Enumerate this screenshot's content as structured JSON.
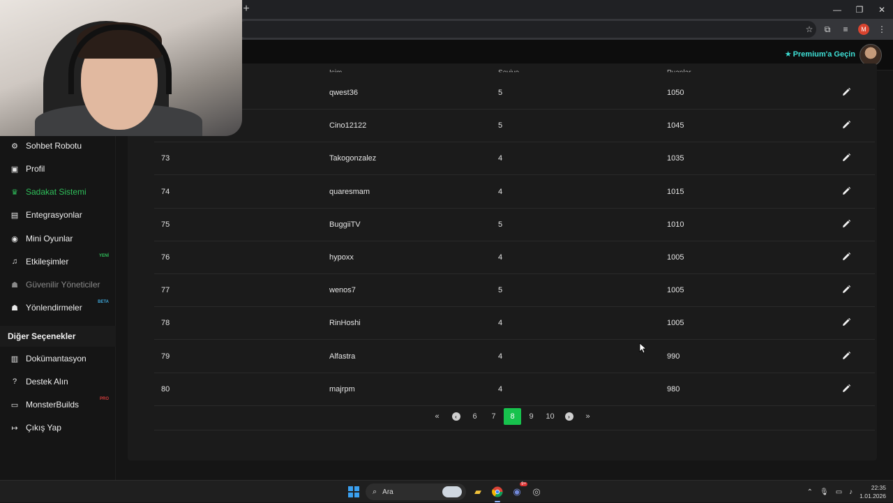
{
  "browser": {
    "new_tab_symbol": "+",
    "window_controls": [
      "—",
      "❐",
      "✕"
    ],
    "toolbar_icons": [
      "star-icon",
      "extensions-icon",
      "media-icon",
      "profile-icon",
      "menu-icon"
    ],
    "profile_letter": "M"
  },
  "header": {
    "premium_label": "Premium'a Geçin"
  },
  "sidebar": {
    "items": [
      {
        "label": "Sohbet Robotu",
        "icon": "robot-icon",
        "glyph": "⚙",
        "state": "normal",
        "badge": ""
      },
      {
        "label": "Profil",
        "icon": "id-card-icon",
        "glyph": "▣",
        "state": "normal",
        "badge": ""
      },
      {
        "label": "Sadakat Sistemi",
        "icon": "trophy-icon",
        "glyph": "♛",
        "state": "active",
        "badge": ""
      },
      {
        "label": "Entegrasyonlar",
        "icon": "integrations-icon",
        "glyph": "▤",
        "state": "normal",
        "badge": ""
      },
      {
        "label": "Mini Oyunlar",
        "icon": "gamepad-icon",
        "glyph": "◉",
        "state": "normal",
        "badge": ""
      },
      {
        "label": "Etkileşimler",
        "icon": "music-icon",
        "glyph": "♫",
        "state": "normal",
        "badge": "YENİ"
      },
      {
        "label": "Güvenilir Yöneticiler",
        "icon": "users-cog-icon",
        "glyph": "☗",
        "state": "disabled",
        "badge": ""
      },
      {
        "label": "Yönlendirmeler",
        "icon": "users-icon",
        "glyph": "☗",
        "state": "normal",
        "badge": "BETA"
      }
    ],
    "section_title": "Diğer Seçenekler",
    "other_items": [
      {
        "label": "Dokümantasyon",
        "icon": "scroll-icon",
        "glyph": "▥",
        "badge": ""
      },
      {
        "label": "Destek Alın",
        "icon": "question-circle-icon",
        "glyph": "?",
        "badge": ""
      },
      {
        "label": "MonsterBuilds",
        "icon": "laptop-icon",
        "glyph": "▭",
        "badge": "PRO"
      },
      {
        "label": "Çıkış Yap",
        "icon": "sign-out-icon",
        "glyph": "↦",
        "badge": ""
      }
    ],
    "colors": {
      "active": "#2fbf5a",
      "badge_new": "#2fbf5a",
      "badge_beta": "#3ea6d8",
      "badge_pro": "#d03b3b"
    }
  },
  "table": {
    "headers": [
      "İsim",
      "Seviye",
      "Puanlar"
    ],
    "rows": [
      {
        "rank": "",
        "name": "qwest36",
        "level": "5",
        "points": "1050"
      },
      {
        "rank": "",
        "name": "Cino12122",
        "level": "5",
        "points": "1045"
      },
      {
        "rank": "73",
        "name": "Takogonzalez",
        "level": "4",
        "points": "1035"
      },
      {
        "rank": "74",
        "name": "quaresmam",
        "level": "4",
        "points": "1015"
      },
      {
        "rank": "75",
        "name": "BuggiiTV",
        "level": "5",
        "points": "1010"
      },
      {
        "rank": "76",
        "name": "hypoxx",
        "level": "4",
        "points": "1005"
      },
      {
        "rank": "77",
        "name": "wenos7",
        "level": "5",
        "points": "1005"
      },
      {
        "rank": "78",
        "name": "RinHoshi",
        "level": "4",
        "points": "1005"
      },
      {
        "rank": "79",
        "name": "Alfastra",
        "level": "4",
        "points": "990"
      },
      {
        "rank": "80",
        "name": "majrpm",
        "level": "4",
        "points": "980"
      }
    ]
  },
  "pagination": {
    "first": "«",
    "prev": "‹",
    "pages": [
      "6",
      "7",
      "8",
      "9",
      "10"
    ],
    "current": "8",
    "next": "›",
    "last": "»",
    "current_color": "#17c24d"
  },
  "taskbar": {
    "search_label": "Ara",
    "apps": [
      "file-explorer-icon",
      "chrome-icon",
      "discord-icon",
      "obs-icon"
    ],
    "discord_badge": "9+",
    "time": "22:35",
    "date": "1.01.2026"
  }
}
